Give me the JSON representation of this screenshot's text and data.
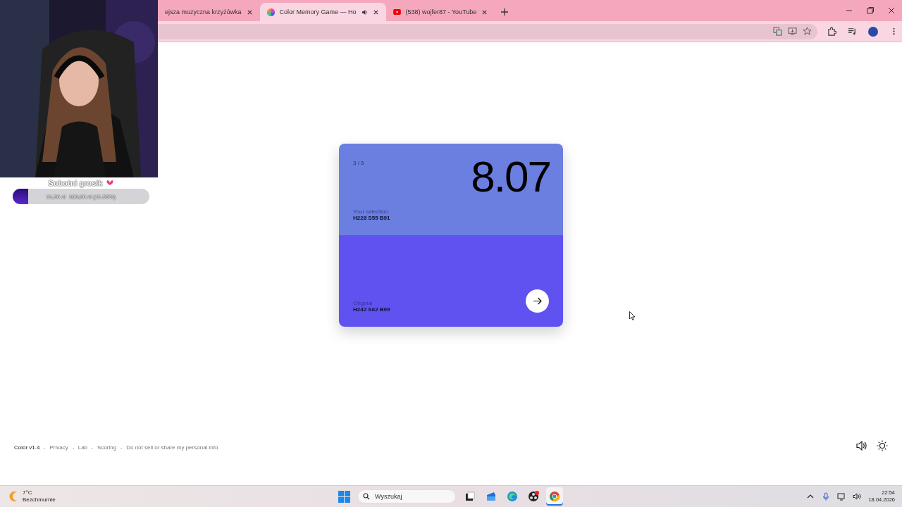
{
  "browser": {
    "tabs": [
      {
        "title": "ejsza muzyczna krzyżówka",
        "kind": "plain",
        "audio": false,
        "selected": false
      },
      {
        "title": "Color Memory Game — Ho",
        "kind": "color-wheel",
        "audio": true,
        "selected": true
      },
      {
        "title": "(538) wojfer87 - YouTube",
        "kind": "video",
        "audio": false,
        "selected": false
      }
    ]
  },
  "card": {
    "round": "3 / 5",
    "score": "8.07",
    "panels": [
      {
        "label": "Your selection",
        "value": "H228 S55 B91",
        "color": "#6b7fe0"
      },
      {
        "label": "Original",
        "value": "H242 S62 B99",
        "color": "#5f52f0"
      }
    ]
  },
  "footer": {
    "links": [
      "Color v1.4",
      "Privacy",
      "Lab",
      "Scoring",
      "Do not sell or share my personal info"
    ]
  },
  "overlay": {
    "goal": {
      "title": "Sobotni grosik",
      "reading": "11,56 zł  100,00 zł (11.56%)",
      "level": 0.1156
    }
  },
  "taskbar": {
    "weather": {
      "temp": "7°C",
      "desc": "Bezchmurnie"
    },
    "search": {
      "placeholder": "Wyszukaj"
    },
    "apps": [
      {
        "kind": "task-view",
        "selected": false
      },
      {
        "kind": "mail",
        "selected": false
      },
      {
        "kind": "edge",
        "selected": false
      },
      {
        "kind": "obs",
        "selected": false
      },
      {
        "kind": "chrome",
        "selected": true
      }
    ],
    "clock": {
      "time": "22:54",
      "date": "18.04.2026"
    }
  }
}
